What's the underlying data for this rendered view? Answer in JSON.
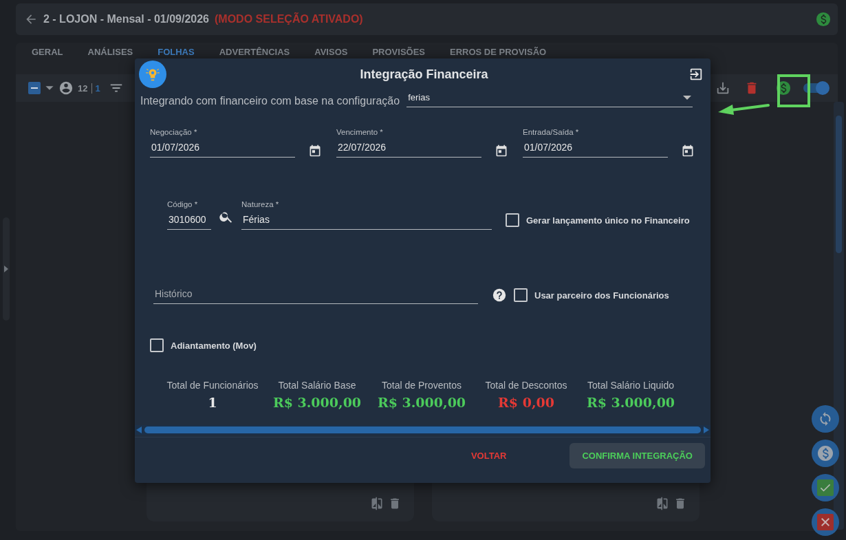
{
  "header": {
    "title": "2 - LOJON - Mensal - 01/09/2026",
    "mode": "(MODO SELEÇÃO ATIVADO)"
  },
  "tabs": [
    {
      "label": "GERAL",
      "selected": false
    },
    {
      "label": "ANÁLISES",
      "selected": false
    },
    {
      "label": "FOLHAS",
      "selected": true
    },
    {
      "label": "ADVERTÊNCIAS",
      "selected": false
    },
    {
      "label": "AVISOS",
      "selected": false
    },
    {
      "label": "PROVISÕES",
      "selected": false
    },
    {
      "label": "ERROS DE PROVISÃO",
      "selected": false
    }
  ],
  "toolbar": {
    "select_all_indeterminate": true,
    "count": "12",
    "selected_count": "1",
    "toggle_on": true
  },
  "dialog": {
    "title": "Integração Financeira",
    "config_label": "Integrando com financeiro com base na configuração",
    "config_value": "ferias",
    "dates": [
      {
        "label": "Negociação *",
        "value": "01/07/2026"
      },
      {
        "label": "Vencimento *",
        "value": "22/07/2026"
      },
      {
        "label": "Entrada/Saída *",
        "value": "01/07/2026"
      }
    ],
    "codigo": {
      "label": "Código *",
      "value": "3010600"
    },
    "natureza": {
      "label": "Natureza *",
      "value": "Férias"
    },
    "historico": {
      "placeholder": "Histórico"
    },
    "checkboxes": [
      {
        "label": "Gerar lançamento único no Financeiro",
        "checked": false
      },
      {
        "label": "Usar parceiro dos Funcionários",
        "checked": false
      },
      {
        "label": "Adiantamento (Mov)",
        "checked": false
      }
    ],
    "totals": [
      {
        "label": "Total de Funcionários",
        "value": "1",
        "kind": "neutral"
      },
      {
        "label": "Total Salário Base",
        "value": "R$ 3.000,00",
        "kind": "positive"
      },
      {
        "label": "Total de Proventos",
        "value": "R$ 3.000,00",
        "kind": "positive"
      },
      {
        "label": "Total de Descontos",
        "value": "R$ 0,00",
        "kind": "negative"
      },
      {
        "label": "Total Salário Liquido",
        "value": "R$ 3.000,00",
        "kind": "positive"
      }
    ],
    "buttons": [
      {
        "label": "VOLTAR",
        "kind": "text"
      },
      {
        "label": "CONFIRMA INTEGRAÇÃO",
        "kind": "filled"
      }
    ]
  }
}
